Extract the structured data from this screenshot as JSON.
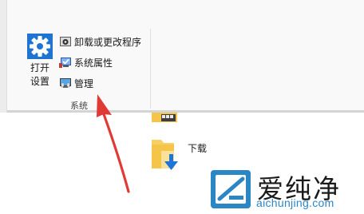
{
  "ribbon": {
    "open_settings": {
      "line1": "打开",
      "line2": "设置",
      "icon": "gear-icon"
    },
    "commands": [
      {
        "label": "卸载或更改程序",
        "icon": "uninstall-icon"
      },
      {
        "label": "系统属性",
        "icon": "system-properties-icon"
      },
      {
        "label": "管理",
        "icon": "computer-management-icon"
      }
    ],
    "group_label": "系统"
  },
  "content": {
    "folders": [
      {
        "label": "下载",
        "icon": "downloads-folder-icon"
      }
    ]
  },
  "watermark": {
    "cn": "爱纯净",
    "url": "aichunjing.com"
  },
  "colors": {
    "accent": "#1f74d1",
    "arrow": "#e03a34",
    "folder": "#f5c54a",
    "watermark_url": "#2b86c6"
  }
}
